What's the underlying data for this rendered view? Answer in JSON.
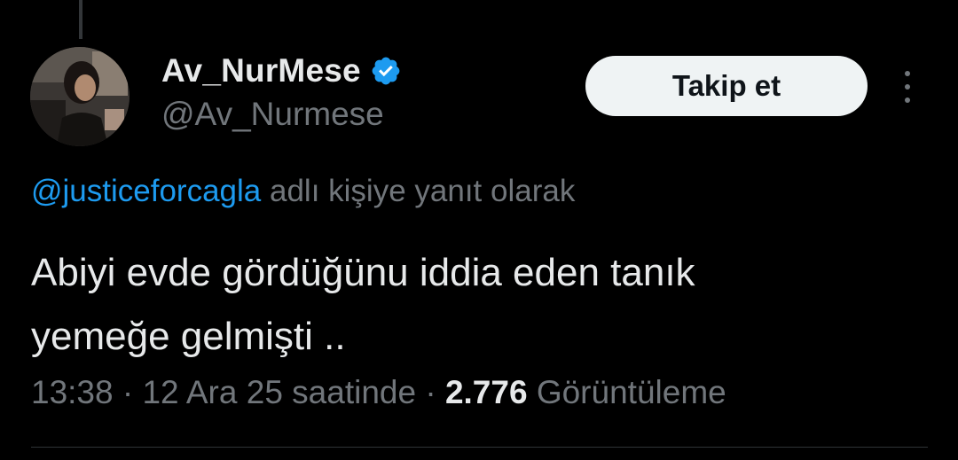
{
  "author": {
    "display_name": "Av_NurMese",
    "handle": "@Av_Nurmese",
    "verified": true
  },
  "actions": {
    "follow_label": "Takip et"
  },
  "reply_context": {
    "mention": "@justiceforcagla",
    "suffix": "adlı kişiye yanıt olarak"
  },
  "tweet": {
    "line1": "Abiyi evde gördüğünu iddia eden tanık",
    "line2": "yemeğe gelmişti .."
  },
  "meta": {
    "time": "13:38",
    "separator": "·",
    "date": "12 Ara 25 saatinde",
    "views_count": "2.776",
    "views_label": "Görüntüleme"
  },
  "colors": {
    "background": "#000000",
    "text": "#e7e9ea",
    "muted": "#71767b",
    "accent": "#1d9bf0",
    "button_bg": "#eff3f4"
  },
  "icons": {
    "verified": "verified-badge-icon",
    "more": "more-vertical-icon"
  }
}
